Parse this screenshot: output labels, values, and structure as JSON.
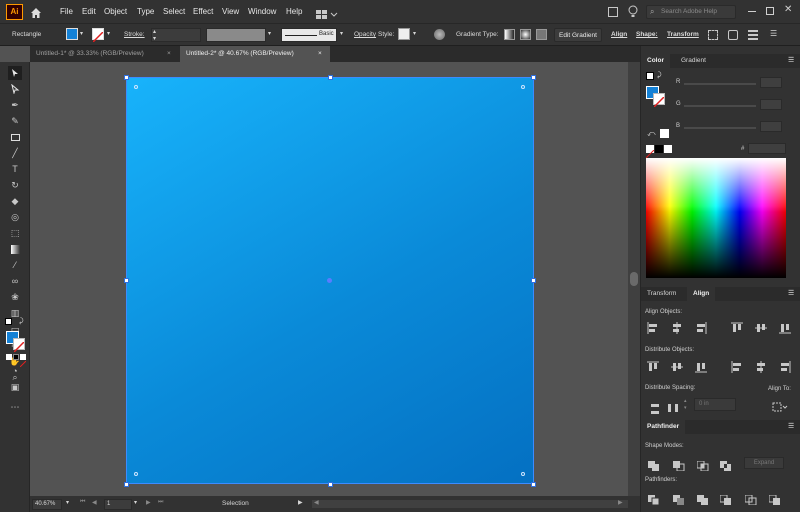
{
  "app": {
    "logo": "Ai"
  },
  "menu": [
    "File",
    "Edit",
    "Object",
    "Type",
    "Select",
    "Effect",
    "View",
    "Window",
    "Help"
  ],
  "search": {
    "placeholder": "Search Adobe Help"
  },
  "control": {
    "tool_name": "Rectangle",
    "stroke_label": "Stroke:",
    "brush_label": "Basic",
    "opacity_label": "Opacity",
    "style_label": "Style:",
    "gradient_type_label": "Gradient Type:",
    "edit_gradient": "Edit Gradient",
    "align": "Align",
    "shape": "Shape:",
    "transform": "Transform"
  },
  "tabs": [
    {
      "label": "Untitled-1* @ 33.33% (RGB/Preview)",
      "close": "×",
      "active": false
    },
    {
      "label": "Untitled-2* @ 40.67% (RGB/Preview)",
      "close": "×",
      "active": true
    }
  ],
  "status": {
    "zoom": "40.67%",
    "artboard": "1",
    "tool": "Selection"
  },
  "color_panel": {
    "tabs": [
      "Color",
      "Gradient"
    ],
    "channels": [
      "R",
      "G",
      "B"
    ],
    "hex_label": "#",
    "colors": {
      "fill": "#1481d6",
      "accent": "#3d8cff",
      "grad_start": "#18b3fb",
      "grad_end": "#0470c2"
    }
  },
  "align_panel": {
    "tabs": [
      "Transform",
      "Align"
    ],
    "align_objects": "Align Objects:",
    "distribute_objects": "Distribute Objects:",
    "distribute_spacing": "Distribute Spacing:",
    "align_to": "Align To:",
    "spacing_value": "0 in"
  },
  "pathfinder": {
    "tab": "Pathfinder",
    "shape_modes": "Shape Modes:",
    "expand": "Expand",
    "pathfinders": "Pathfinders:"
  }
}
